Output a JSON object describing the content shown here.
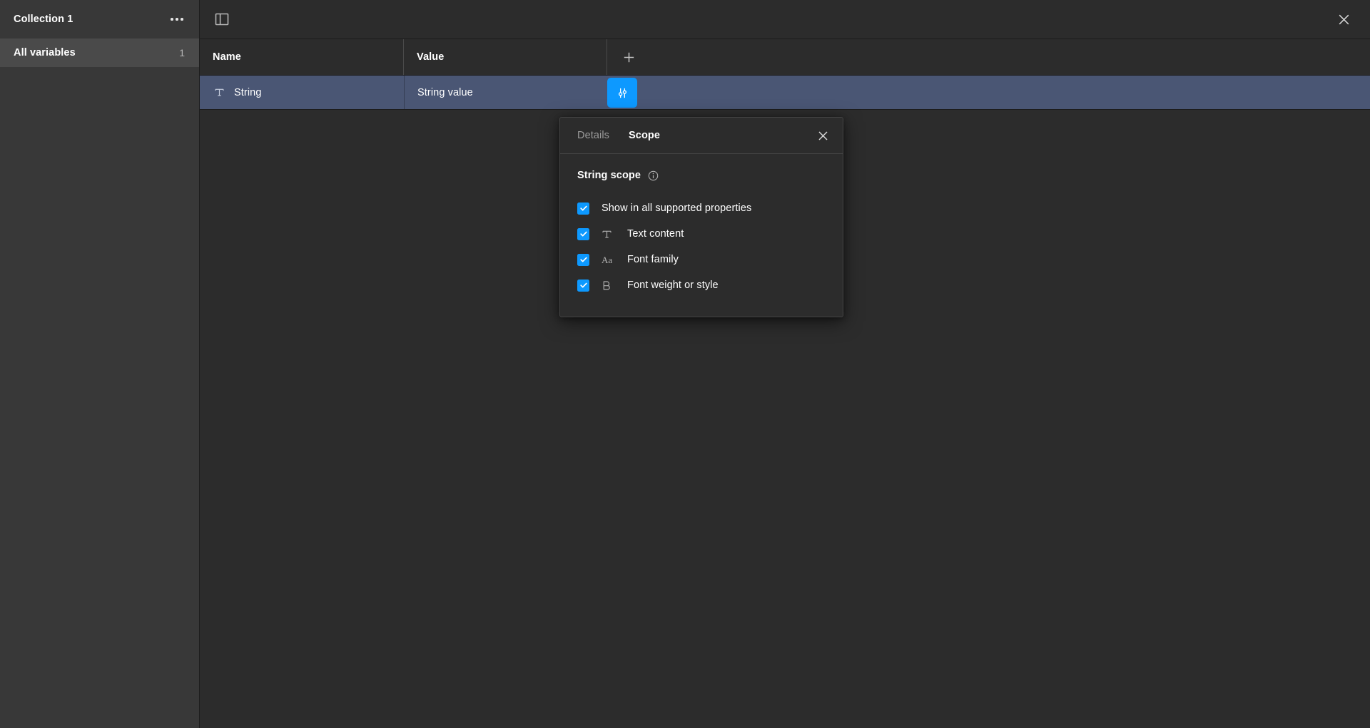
{
  "sidebar": {
    "collection_title": "Collection 1",
    "more_menu": "…",
    "items": [
      {
        "label": "All variables",
        "count": "1",
        "selected": true
      }
    ]
  },
  "topbar": {
    "panel_toggle_icon": "sidebar-panel-toggle-icon",
    "close_icon": "close-icon"
  },
  "table": {
    "columns": [
      {
        "header": "Name"
      },
      {
        "header": "Value"
      }
    ],
    "add_label": "+",
    "rows": [
      {
        "type_icon": "text-type-icon",
        "name": "String",
        "value": "String value",
        "selected": true,
        "scope_button_icon": "sliders-icon"
      }
    ]
  },
  "popover": {
    "tabs": [
      {
        "label": "Details",
        "active": false
      },
      {
        "label": "Scope",
        "active": true
      }
    ],
    "close_icon": "close-icon",
    "section_title": "String scope",
    "info_icon": "info-icon",
    "options": [
      {
        "label": "Show in all supported properties",
        "checked": true,
        "icon": ""
      },
      {
        "label": "Text content",
        "checked": true,
        "icon": "text-content-icon",
        "glyph": "T"
      },
      {
        "label": "Font family",
        "checked": true,
        "icon": "font-family-icon",
        "glyph": "Aa"
      },
      {
        "label": "Font weight or style",
        "checked": true,
        "icon": "font-weight-icon",
        "glyph": "B"
      }
    ]
  },
  "colors": {
    "accent": "#0d99ff",
    "row_selected": "#4a5674",
    "panel_bg": "#2c2c2c",
    "sidebar_bg": "#383838",
    "sidebar_selected": "#4a4a4a"
  }
}
